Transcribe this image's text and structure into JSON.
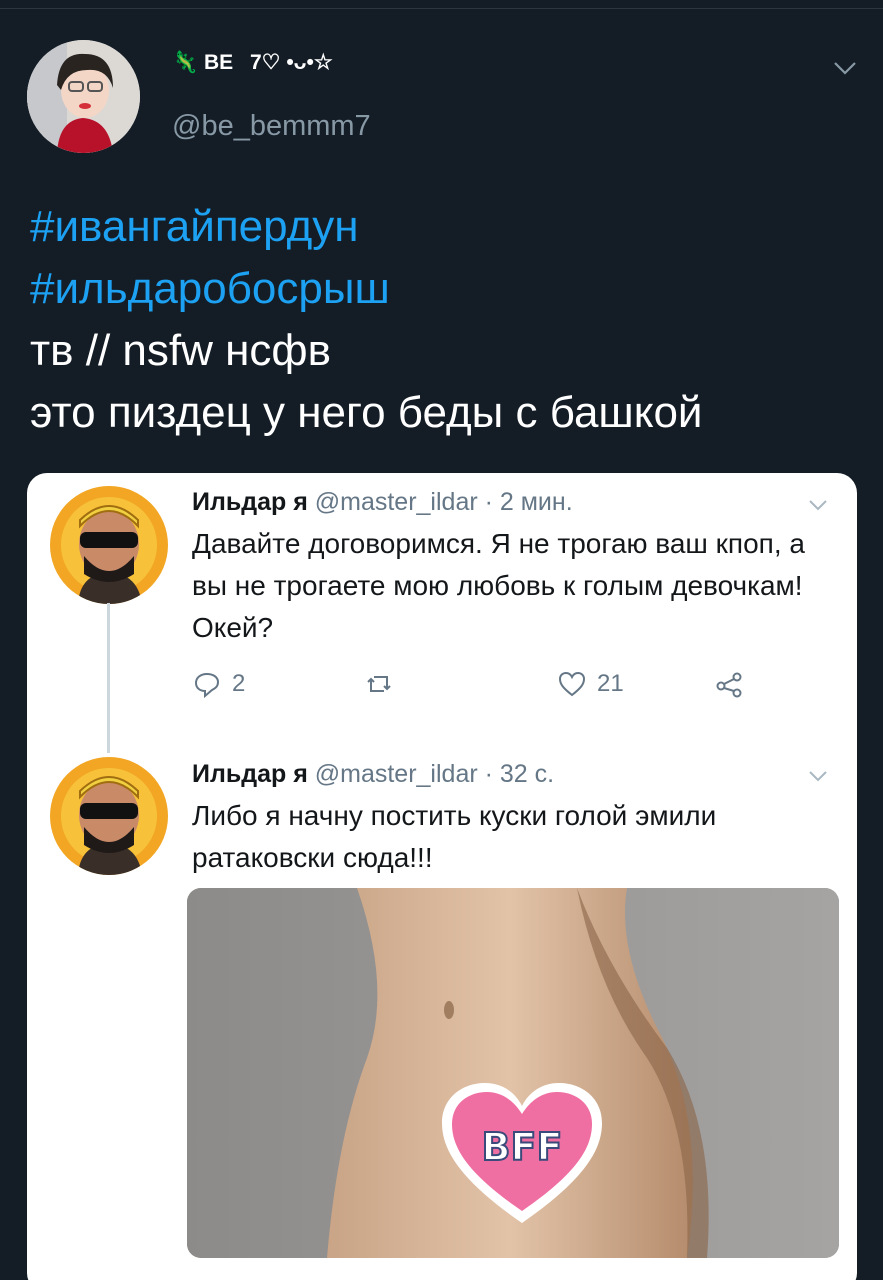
{
  "tweet": {
    "display_name": "ВЕ    7♡ •ᴗ•☆",
    "handle": "@be_bemmm7",
    "lines": [
      "#ивангайпердун",
      "#ильдаробосрыш",
      "тв // nsfw нсфв",
      "это пиздец у него беды с башкой"
    ]
  },
  "embedded": {
    "tweet1": {
      "name": "Ильдар я",
      "meta": "@master_ildar · 2 мин.",
      "body": "Давайте договоримся. Я не трогаю ваш кпоп, а вы не трогаете мою любовь к голым девочкам! Окей?",
      "replies": "2",
      "retweets": "",
      "likes": "21"
    },
    "tweet2": {
      "name": "Ильдар я",
      "meta": "@master_ildar · 32 с.",
      "body": "Либо я начну постить куски голой эмили ратаковски сюда!!!",
      "sticker_text": "BFF"
    }
  },
  "colors": {
    "background": "#141d26",
    "hashtag": "#1da1f2",
    "muted": "#8899a6",
    "sticker": "#f06fa3"
  },
  "icons": [
    "chevron-down-icon",
    "reply-icon",
    "retweet-icon",
    "like-icon",
    "share-icon"
  ]
}
